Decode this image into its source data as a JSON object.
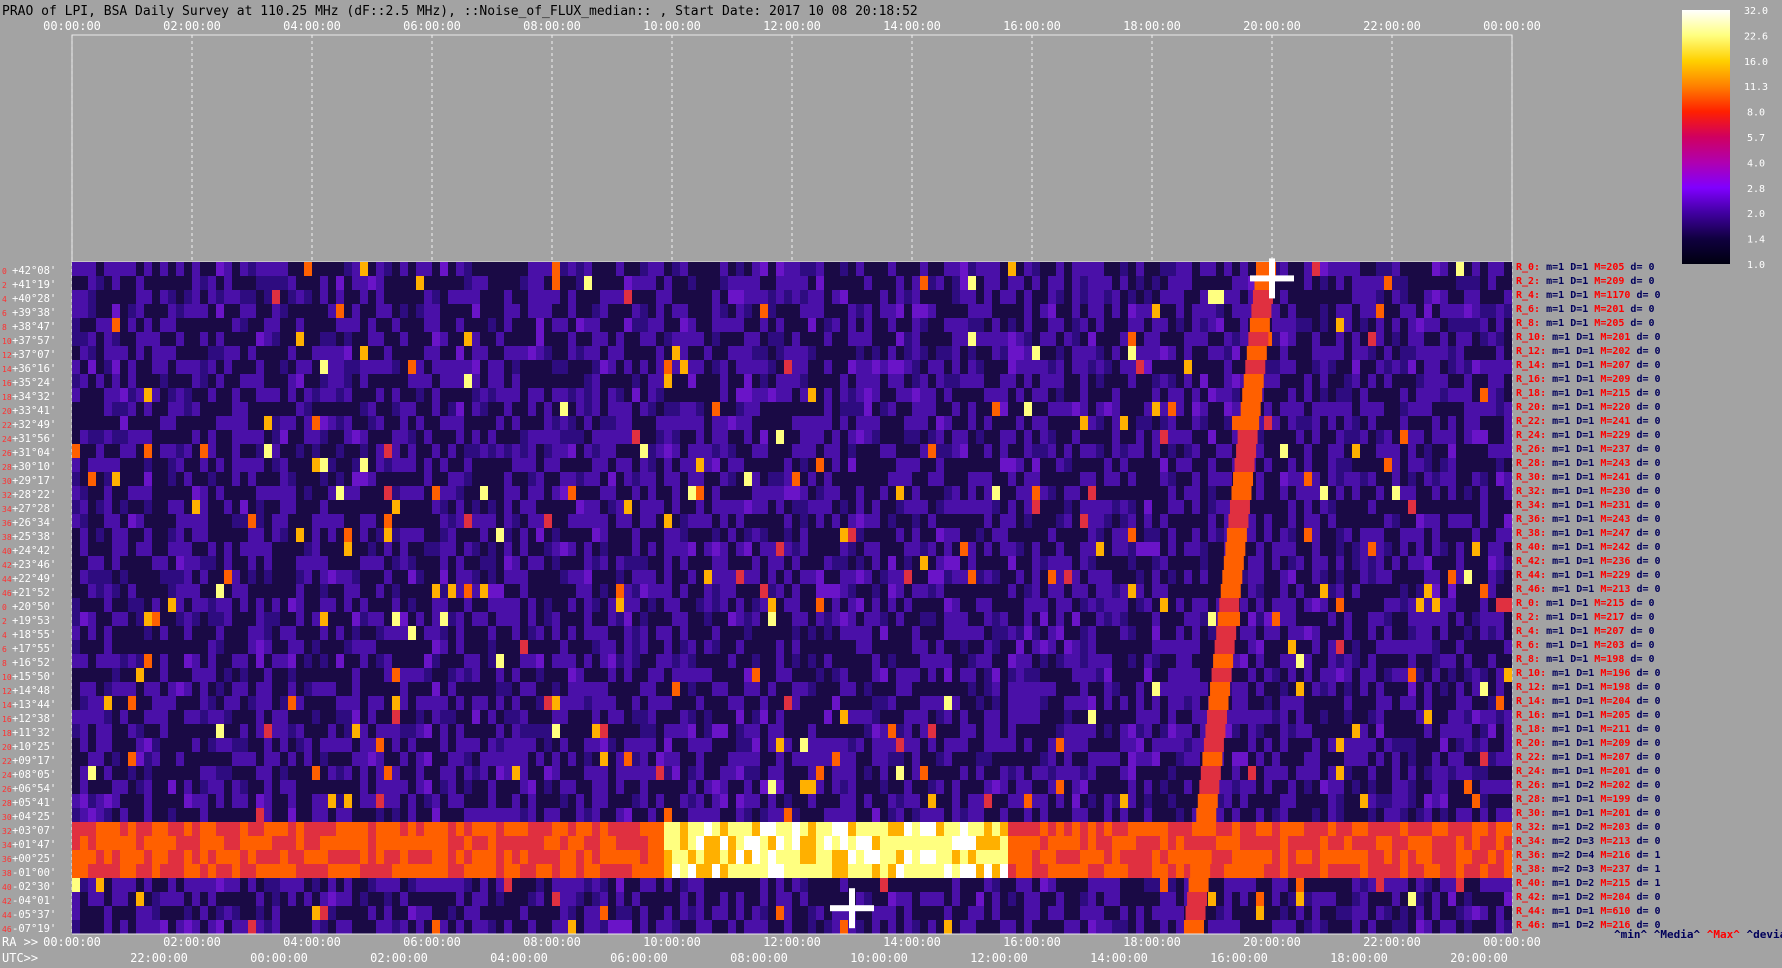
{
  "title": "PRAO of LPI, BSA Daily Survey at 110.25 MHz (dF::2.5 MHz), ::Noise_of_FLUX_median:: , Start Date: 2017 10 08 20:18:52",
  "chart_data": {
    "type": "heatmap",
    "title": "PRAO of LPI, BSA Daily Survey at 110.25 MHz (dF::2.5 MHz), ::Noise_of_FLUX_median:: , Start Date: 2017 10 08 20:18:52",
    "x_top_ticks": [
      "00:00:00",
      "02:00:00",
      "04:00:00",
      "06:00:00",
      "08:00:00",
      "10:00:00",
      "12:00:00",
      "14:00:00",
      "16:00:00",
      "18:00:00",
      "20:00:00",
      "22:00:00",
      "00:00:00"
    ],
    "x_bottom_ra_label": "RA >>",
    "x_bottom_ra_ticks": [
      "00:00:00",
      "02:00:00",
      "04:00:00",
      "06:00:00",
      "08:00:00",
      "10:00:00",
      "12:00:00",
      "14:00:00",
      "16:00:00",
      "18:00:00",
      "20:00:00",
      "22:00:00",
      "00:00:00"
    ],
    "x_bottom_utc_label": "UTC>>",
    "x_bottom_utc_ticks": [
      "22:00:00",
      "00:00:00",
      "02:00:00",
      "04:00:00",
      "06:00:00",
      "08:00:00",
      "10:00:00",
      "12:00:00",
      "14:00:00",
      "16:00:00",
      "18:00:00",
      "20:00:00"
    ],
    "dec_labels": [
      "+42°08'",
      "+41°19'",
      "+40°28'",
      "+39°38'",
      "+38°47'",
      "+37°57'",
      "+37°07'",
      "+36°16'",
      "+35°24'",
      "+34°32'",
      "+33°41'",
      "+32°49'",
      "+31°56'",
      "+31°04'",
      "+30°10'",
      "+29°17'",
      "+28°22'",
      "+27°28'",
      "+26°34'",
      "+25°38'",
      "+24°42'",
      "+23°46'",
      "+22°49'",
      "+21°52'",
      "+20°50'",
      "+19°53'",
      "+18°55'",
      "+17°55'",
      "+16°52'",
      "+15°50'",
      "+14°48'",
      "+13°44'",
      "+12°38'",
      "+11°32'",
      "+10°25'",
      "+09°17'",
      "+08°05'",
      "+06°54'",
      "+05°41'",
      "+04°25'",
      "+03°07'",
      "+01°47'",
      "+00°25'",
      "-01°00'",
      "-02°30'",
      "-04°01'",
      "-05°37'",
      "-07°19'"
    ],
    "row_index_labels": [
      "0",
      "2",
      "4",
      "6",
      "8",
      "10",
      "12",
      "14",
      "16",
      "18",
      "20",
      "22",
      "24",
      "26",
      "28",
      "30",
      "32",
      "34",
      "36",
      "38",
      "40",
      "42",
      "44",
      "46",
      "0",
      "2",
      "4",
      "6",
      "8",
      "10",
      "12",
      "14",
      "16",
      "18",
      "20",
      "22",
      "24",
      "26",
      "28",
      "30",
      "32",
      "34",
      "36",
      "38",
      "40",
      "42",
      "44",
      "46"
    ],
    "colorbar": {
      "ticks": [
        "32.0",
        "22.6",
        "16.0",
        "11.3",
        "8.0",
        "5.7",
        "4.0",
        "2.8",
        "2.0",
        "1.4",
        "1.0"
      ],
      "colors": [
        "#ffffff",
        "#ffff80",
        "#ffd000",
        "#ff8000",
        "#ff2000",
        "#d00060",
        "#b000b0",
        "#8000ff",
        "#4000a0",
        "#100040",
        "#000010"
      ]
    },
    "features": [
      {
        "label": "sun-track",
        "ra_start": 18.7,
        "ra_end": 19.9,
        "dec_start": -7.3,
        "dec_end": 42.1
      },
      {
        "label": "galactic-band",
        "dec_from": -1.0,
        "dec_to": 3.1
      },
      {
        "label": "bright-source",
        "ra": 20.0,
        "dec": 41.3
      },
      {
        "label": "bright-source",
        "ra": 13.0,
        "dec": -5.6
      }
    ],
    "row_stats": [
      {
        "r": "R_0:",
        "m": "m=1",
        "d": "D=1",
        "M": "M=205",
        "dev": "d= 0"
      },
      {
        "r": "R_2:",
        "m": "m=1",
        "d": "D=1",
        "M": "M=209",
        "dev": "d= 0"
      },
      {
        "r": "R_4:",
        "m": "m=1",
        "d": "D=1",
        "M": "M=1170",
        "dev": "d= 0"
      },
      {
        "r": "R_6:",
        "m": "m=1",
        "d": "D=1",
        "M": "M=201",
        "dev": "d= 0"
      },
      {
        "r": "R_8:",
        "m": "m=1",
        "d": "D=1",
        "M": "M=205",
        "dev": "d= 0"
      },
      {
        "r": "R_10:",
        "m": "m=1",
        "d": "D=1",
        "M": "M=201",
        "dev": "d= 0"
      },
      {
        "r": "R_12:",
        "m": "m=1",
        "d": "D=1",
        "M": "M=202",
        "dev": "d= 0"
      },
      {
        "r": "R_14:",
        "m": "m=1",
        "d": "D=1",
        "M": "M=207",
        "dev": "d= 0"
      },
      {
        "r": "R_16:",
        "m": "m=1",
        "d": "D=1",
        "M": "M=209",
        "dev": "d= 0"
      },
      {
        "r": "R_18:",
        "m": "m=1",
        "d": "D=1",
        "M": "M=215",
        "dev": "d= 0"
      },
      {
        "r": "R_20:",
        "m": "m=1",
        "d": "D=1",
        "M": "M=220",
        "dev": "d= 0"
      },
      {
        "r": "R_22:",
        "m": "m=1",
        "d": "D=1",
        "M": "M=241",
        "dev": "d= 0"
      },
      {
        "r": "R_24:",
        "m": "m=1",
        "d": "D=1",
        "M": "M=229",
        "dev": "d= 0"
      },
      {
        "r": "R_26:",
        "m": "m=1",
        "d": "D=1",
        "M": "M=237",
        "dev": "d= 0"
      },
      {
        "r": "R_28:",
        "m": "m=1",
        "d": "D=1",
        "M": "M=243",
        "dev": "d= 0"
      },
      {
        "r": "R_30:",
        "m": "m=1",
        "d": "D=1",
        "M": "M=241",
        "dev": "d= 0"
      },
      {
        "r": "R_32:",
        "m": "m=1",
        "d": "D=1",
        "M": "M=230",
        "dev": "d= 0"
      },
      {
        "r": "R_34:",
        "m": "m=1",
        "d": "D=1",
        "M": "M=231",
        "dev": "d= 0"
      },
      {
        "r": "R_36:",
        "m": "m=1",
        "d": "D=1",
        "M": "M=243",
        "dev": "d= 0"
      },
      {
        "r": "R_38:",
        "m": "m=1",
        "d": "D=1",
        "M": "M=247",
        "dev": "d= 0"
      },
      {
        "r": "R_40:",
        "m": "m=1",
        "d": "D=1",
        "M": "M=242",
        "dev": "d= 0"
      },
      {
        "r": "R_42:",
        "m": "m=1",
        "d": "D=1",
        "M": "M=236",
        "dev": "d= 0"
      },
      {
        "r": "R_44:",
        "m": "m=1",
        "d": "D=1",
        "M": "M=229",
        "dev": "d= 0"
      },
      {
        "r": "R_46:",
        "m": "m=1",
        "d": "D=1",
        "M": "M=213",
        "dev": "d= 0"
      },
      {
        "r": "R_0:",
        "m": "m=1",
        "d": "D=1",
        "M": "M=215",
        "dev": "d= 0"
      },
      {
        "r": "R_2:",
        "m": "m=1",
        "d": "D=1",
        "M": "M=217",
        "dev": "d= 0"
      },
      {
        "r": "R_4:",
        "m": "m=1",
        "d": "D=1",
        "M": "M=207",
        "dev": "d= 0"
      },
      {
        "r": "R_6:",
        "m": "m=1",
        "d": "D=1",
        "M": "M=203",
        "dev": "d= 0"
      },
      {
        "r": "R_8:",
        "m": "m=1",
        "d": "D=1",
        "M": "M=198",
        "dev": "d= 0"
      },
      {
        "r": "R_10:",
        "m": "m=1",
        "d": "D=1",
        "M": "M=196",
        "dev": "d= 0"
      },
      {
        "r": "R_12:",
        "m": "m=1",
        "d": "D=1",
        "M": "M=198",
        "dev": "d= 0"
      },
      {
        "r": "R_14:",
        "m": "m=1",
        "d": "D=1",
        "M": "M=204",
        "dev": "d= 0"
      },
      {
        "r": "R_16:",
        "m": "m=1",
        "d": "D=1",
        "M": "M=205",
        "dev": "d= 0"
      },
      {
        "r": "R_18:",
        "m": "m=1",
        "d": "D=1",
        "M": "M=211",
        "dev": "d= 0"
      },
      {
        "r": "R_20:",
        "m": "m=1",
        "d": "D=1",
        "M": "M=209",
        "dev": "d= 0"
      },
      {
        "r": "R_22:",
        "m": "m=1",
        "d": "D=1",
        "M": "M=207",
        "dev": "d= 0"
      },
      {
        "r": "R_24:",
        "m": "m=1",
        "d": "D=1",
        "M": "M=201",
        "dev": "d= 0"
      },
      {
        "r": "R_26:",
        "m": "m=1",
        "d": "D=2",
        "M": "M=202",
        "dev": "d= 0"
      },
      {
        "r": "R_28:",
        "m": "m=1",
        "d": "D=1",
        "M": "M=199",
        "dev": "d= 0"
      },
      {
        "r": "R_30:",
        "m": "m=1",
        "d": "D=1",
        "M": "M=201",
        "dev": "d= 0"
      },
      {
        "r": "R_32:",
        "m": "m=1",
        "d": "D=2",
        "M": "M=203",
        "dev": "d= 0"
      },
      {
        "r": "R_34:",
        "m": "m=2",
        "d": "D=3",
        "M": "M=213",
        "dev": "d= 0"
      },
      {
        "r": "R_36:",
        "m": "m=2",
        "d": "D=4",
        "M": "M=216",
        "dev": "d= 1"
      },
      {
        "r": "R_38:",
        "m": "m=2",
        "d": "D=3",
        "M": "M=237",
        "dev": "d= 1"
      },
      {
        "r": "R_40:",
        "m": "m=1",
        "d": "D=2",
        "M": "M=215",
        "dev": "d= 1"
      },
      {
        "r": "R_42:",
        "m": "m=1",
        "d": "D=2",
        "M": "M=204",
        "dev": "d= 0"
      },
      {
        "r": "R_44:",
        "m": "m=1",
        "d": "D=1",
        "M": "M=610",
        "dev": "d= 0"
      },
      {
        "r": "R_46:",
        "m": "m=1",
        "d": "D=2",
        "M": "M=216",
        "dev": "d= 0"
      }
    ],
    "stat_legend": {
      "min": "^min^",
      "media": "^Media^",
      "max": "^Max^",
      "devia": "^devia^"
    }
  }
}
